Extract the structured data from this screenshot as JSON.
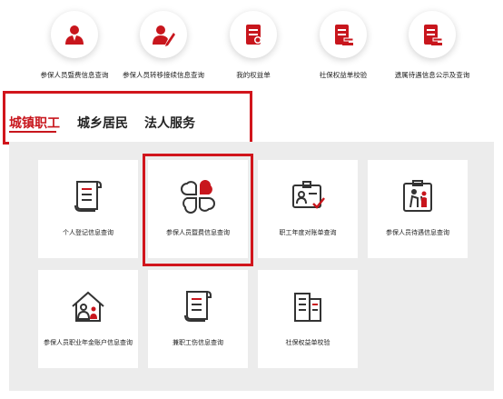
{
  "top_items": [
    {
      "label": "参保人员暨费信息查询",
      "icon": "person-badge-icon"
    },
    {
      "label": "参保人员转移接续信息查询",
      "icon": "person-pen-icon"
    },
    {
      "label": "我的权益单",
      "icon": "document-edit-icon"
    },
    {
      "label": "社保权益单校验",
      "icon": "document-gavel-icon"
    },
    {
      "label": "遗属待遇信息公示及查询",
      "icon": "document-gavel-icon"
    }
  ],
  "tabs": [
    {
      "label": "城镇职工",
      "active": true
    },
    {
      "label": "城乡居民",
      "active": false
    },
    {
      "label": "法人服务",
      "active": false
    }
  ],
  "cards": [
    {
      "label": "个人登记信息查询",
      "icon": "scroll-document-icon"
    },
    {
      "label": "参保人员暨费信息查询",
      "icon": "four-petal-icon"
    },
    {
      "label": "职工年度对账单查询",
      "icon": "id-card-check-icon"
    },
    {
      "label": "参保人员待遇信息查询",
      "icon": "elderly-person-card-icon"
    },
    {
      "label": "参保人员职业年金账户信息查询",
      "icon": "house-people-icon"
    },
    {
      "label": "兼职工伤信息查询",
      "icon": "scroll-document-icon"
    },
    {
      "label": "社保权益单校验",
      "icon": "buildings-icon"
    }
  ],
  "colors": {
    "accent": "#c8161d",
    "highlight": "#d1151c",
    "grid_bg": "#ececec"
  }
}
